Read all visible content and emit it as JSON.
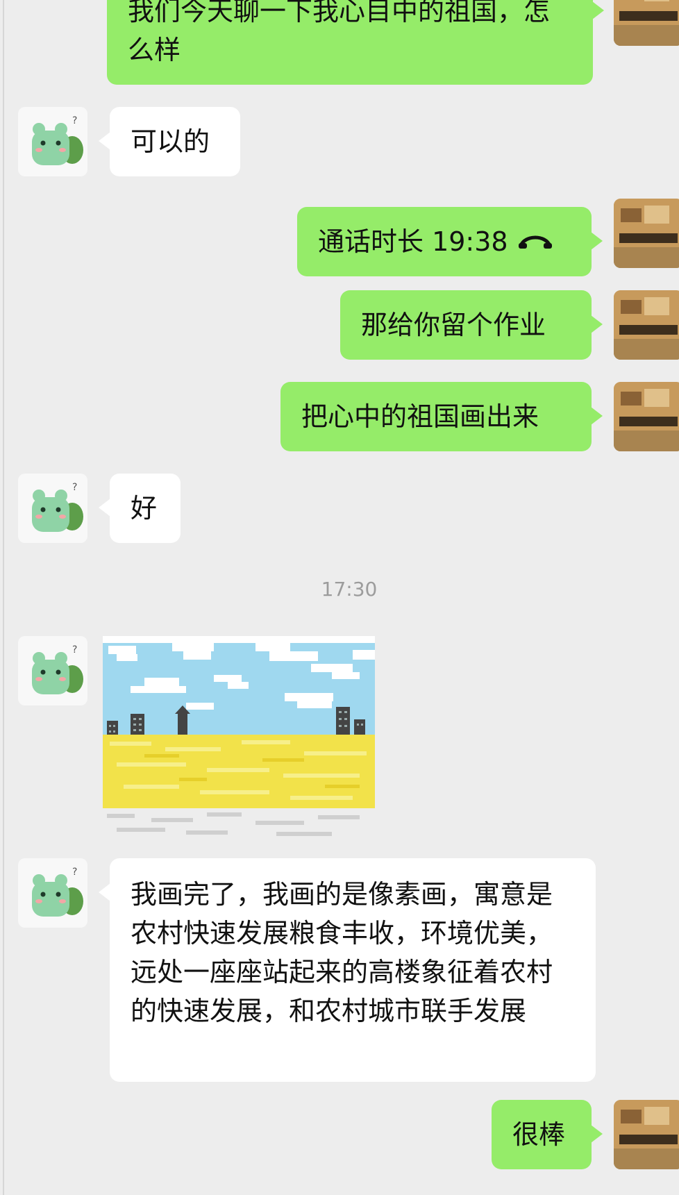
{
  "messages": [
    {
      "sender": "self",
      "text": "我们今天聊一下我心目中的祖国，怎么样"
    },
    {
      "sender": "other",
      "text": "可以的"
    },
    {
      "sender": "self",
      "type": "call",
      "label": "通话时长 19:38",
      "icon": "phone-hangup-icon"
    },
    {
      "sender": "self",
      "text": "那给你留个作业"
    },
    {
      "sender": "self",
      "text": "把心中的祖国画出来"
    },
    {
      "sender": "other",
      "text": "好"
    },
    {
      "type": "time",
      "text": "17:30"
    },
    {
      "sender": "other",
      "type": "image",
      "content": "pixel-art-painting"
    },
    {
      "sender": "other",
      "text": "我画完了，我画的是像素画，寓意是农村快速发展粮食丰收，环境优美，远处一座座站起来的高楼象征着农村的快速发展，和农村城市联手发展"
    },
    {
      "sender": "self",
      "text": "很棒"
    }
  ],
  "colors": {
    "background": "#ededed",
    "self_bubble": "#95ec69",
    "other_bubble": "#ffffff",
    "timestamp": "#9c9c9c"
  }
}
